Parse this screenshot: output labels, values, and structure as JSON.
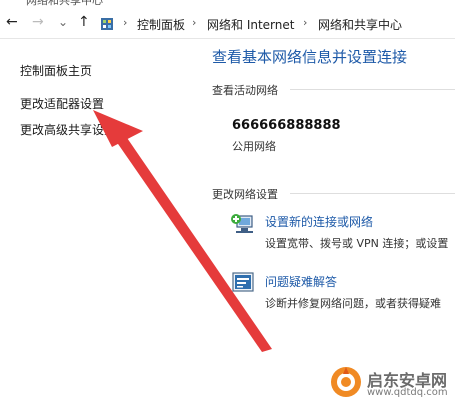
{
  "window": {
    "title": "网络和共享中心"
  },
  "addressbar": {
    "back_icon": "←",
    "forward_icon": "→",
    "recent_icon": "⌄",
    "up_icon": "↑",
    "breadcrumb": [
      "控制面板",
      "网络和 Internet",
      "网络和共享中心"
    ],
    "separator": "›"
  },
  "sidebar": {
    "items": [
      {
        "label": "控制面板主页"
      },
      {
        "label": "更改适配器设置"
      },
      {
        "label": "更改高级共享设置"
      }
    ]
  },
  "main": {
    "title": "查看基本网络信息并设置连接",
    "active_networks_label": "查看活动网络",
    "network": {
      "name": "666666888888",
      "type": "公用网络"
    },
    "change_settings_label": "更改网络设置",
    "tasks": [
      {
        "title": "设置新的连接或网络",
        "desc": "设置宽带、拨号或 VPN 连接；或设置",
        "icon": "network-setup-icon"
      },
      {
        "title": "问题疑难解答",
        "desc": "诊断并修复网络问题，或者获得疑难",
        "icon": "troubleshoot-icon"
      }
    ]
  },
  "annotation": {
    "arrow_color": "#e53b3b"
  },
  "watermark": {
    "text": "启东安卓网",
    "url": "www.qdtdq.com"
  }
}
